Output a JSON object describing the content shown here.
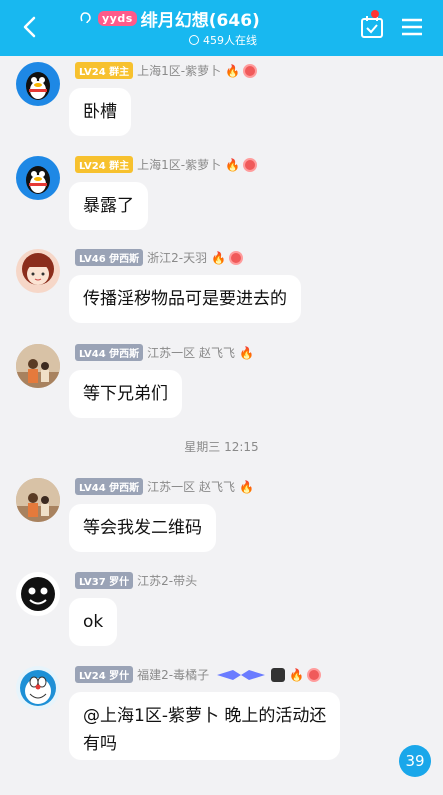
{
  "header": {
    "logo_text": "yyds",
    "title": "绯月幻想(646)",
    "online": "459人在线",
    "accent": "#18b8f0"
  },
  "messages": [
    {
      "level": "LV24",
      "role": "群主",
      "role_color": "gold",
      "name": "上海1区-紫萝卜",
      "text": "卧槽",
      "avatar": "penguin"
    },
    {
      "level": "LV24",
      "role": "群主",
      "role_color": "gold",
      "name": "上海1区-紫萝卜",
      "text": "暴露了",
      "avatar": "penguin"
    },
    {
      "level": "LV46",
      "role": "伊西斯",
      "role_color": "gray",
      "name": "浙江2-天羽",
      "text": "传播淫秽物品可是要进去的",
      "avatar": "girl"
    },
    {
      "level": "LV44",
      "role": "伊西斯",
      "role_color": "gray",
      "name": "江苏一区 赵飞飞",
      "text": "等下兄弟们",
      "avatar": "photo"
    },
    {
      "level": "LV44",
      "role": "伊西斯",
      "role_color": "gray",
      "name": "江苏一区 赵飞飞",
      "text": "等会我发二维码",
      "avatar": "photo"
    },
    {
      "level": "LV37",
      "role": "罗什",
      "role_color": "gray",
      "name": "江苏2-带头",
      "text": "ok",
      "avatar": "dark"
    },
    {
      "level": "LV24",
      "role": "罗什",
      "role_color": "gray",
      "name": "福建2-毒橘子",
      "text_line1": "@上海1区-紫萝卜 晚上的活动还",
      "text_line2": "有吗",
      "avatar": "doraemon"
    }
  ],
  "time_separator": "星期三 12:15",
  "unread_count": "39"
}
